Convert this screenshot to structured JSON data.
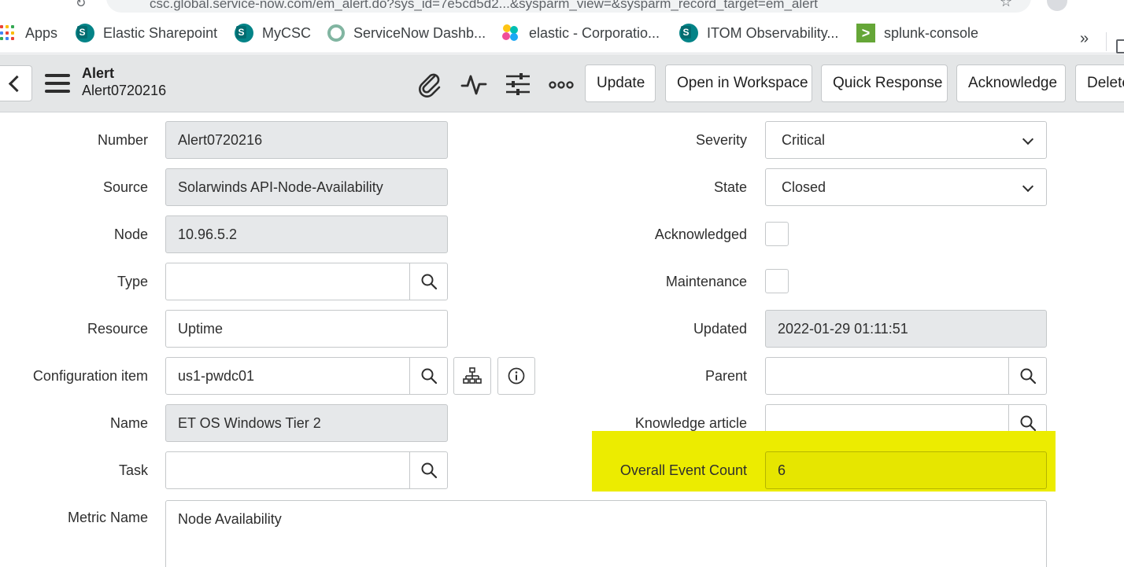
{
  "browser": {
    "url": "csc.global.service-now.com/em_alert.do?sys_id=7e5cd5d2...&sysparm_view=&sysparm_record_target=em_alert"
  },
  "bookmarks": [
    {
      "label": "Apps",
      "icon": "apps-grid-icon"
    },
    {
      "label": "Elastic Sharepoint",
      "icon": "sharepoint-icon"
    },
    {
      "label": "MyCSC",
      "icon": "sharepoint-icon"
    },
    {
      "label": "ServiceNow Dashb...",
      "icon": "servicenow-icon"
    },
    {
      "label": "elastic - Corporatio...",
      "icon": "elastic-icon"
    },
    {
      "label": "ITOM Observability...",
      "icon": "sharepoint-icon"
    },
    {
      "label": "splunk-console",
      "icon": "splunk-icon"
    }
  ],
  "bookmarks_more": "»",
  "header": {
    "title": "Alert",
    "record": "Alert0720216",
    "icons": [
      "paperclip-icon",
      "activity-pulse-icon",
      "sliders-icon",
      "more-options-icon"
    ],
    "buttons": {
      "update": "Update",
      "open_workspace": "Open in Workspace",
      "quick_response": "Quick Response",
      "acknowledge": "Acknowledge",
      "delete": "Delete"
    }
  },
  "form": {
    "number": {
      "label": "Number",
      "value": "Alert0720216"
    },
    "source": {
      "label": "Source",
      "value": "Solarwinds API-Node-Availability"
    },
    "node": {
      "label": "Node",
      "value": "10.96.5.2"
    },
    "type": {
      "label": "Type",
      "value": ""
    },
    "resource": {
      "label": "Resource",
      "value": "Uptime"
    },
    "ci": {
      "label": "Configuration item",
      "value": "us1-pwdc01"
    },
    "name": {
      "label": "Name",
      "value": "ET OS Windows Tier 2"
    },
    "task": {
      "label": "Task",
      "value": ""
    },
    "metric_name": {
      "label": "Metric Name",
      "value": "Node Availability"
    },
    "severity": {
      "label": "Severity",
      "value": "Critical"
    },
    "state": {
      "label": "State",
      "value": "Closed"
    },
    "acknowledged": {
      "label": "Acknowledged",
      "checked": false
    },
    "maintenance": {
      "label": "Maintenance",
      "checked": false
    },
    "updated": {
      "label": "Updated",
      "value": "2022-01-29 01:11:51"
    },
    "parent": {
      "label": "Parent",
      "value": ""
    },
    "knowledge_article": {
      "label": "Knowledge article",
      "value": ""
    },
    "overall_event_count": {
      "label": "Overall Event Count",
      "value": "6"
    }
  },
  "colors": {
    "header_bg": "#e4e6e7",
    "readonly_bg": "#e6e8ea",
    "highlight": "#ecec00"
  }
}
